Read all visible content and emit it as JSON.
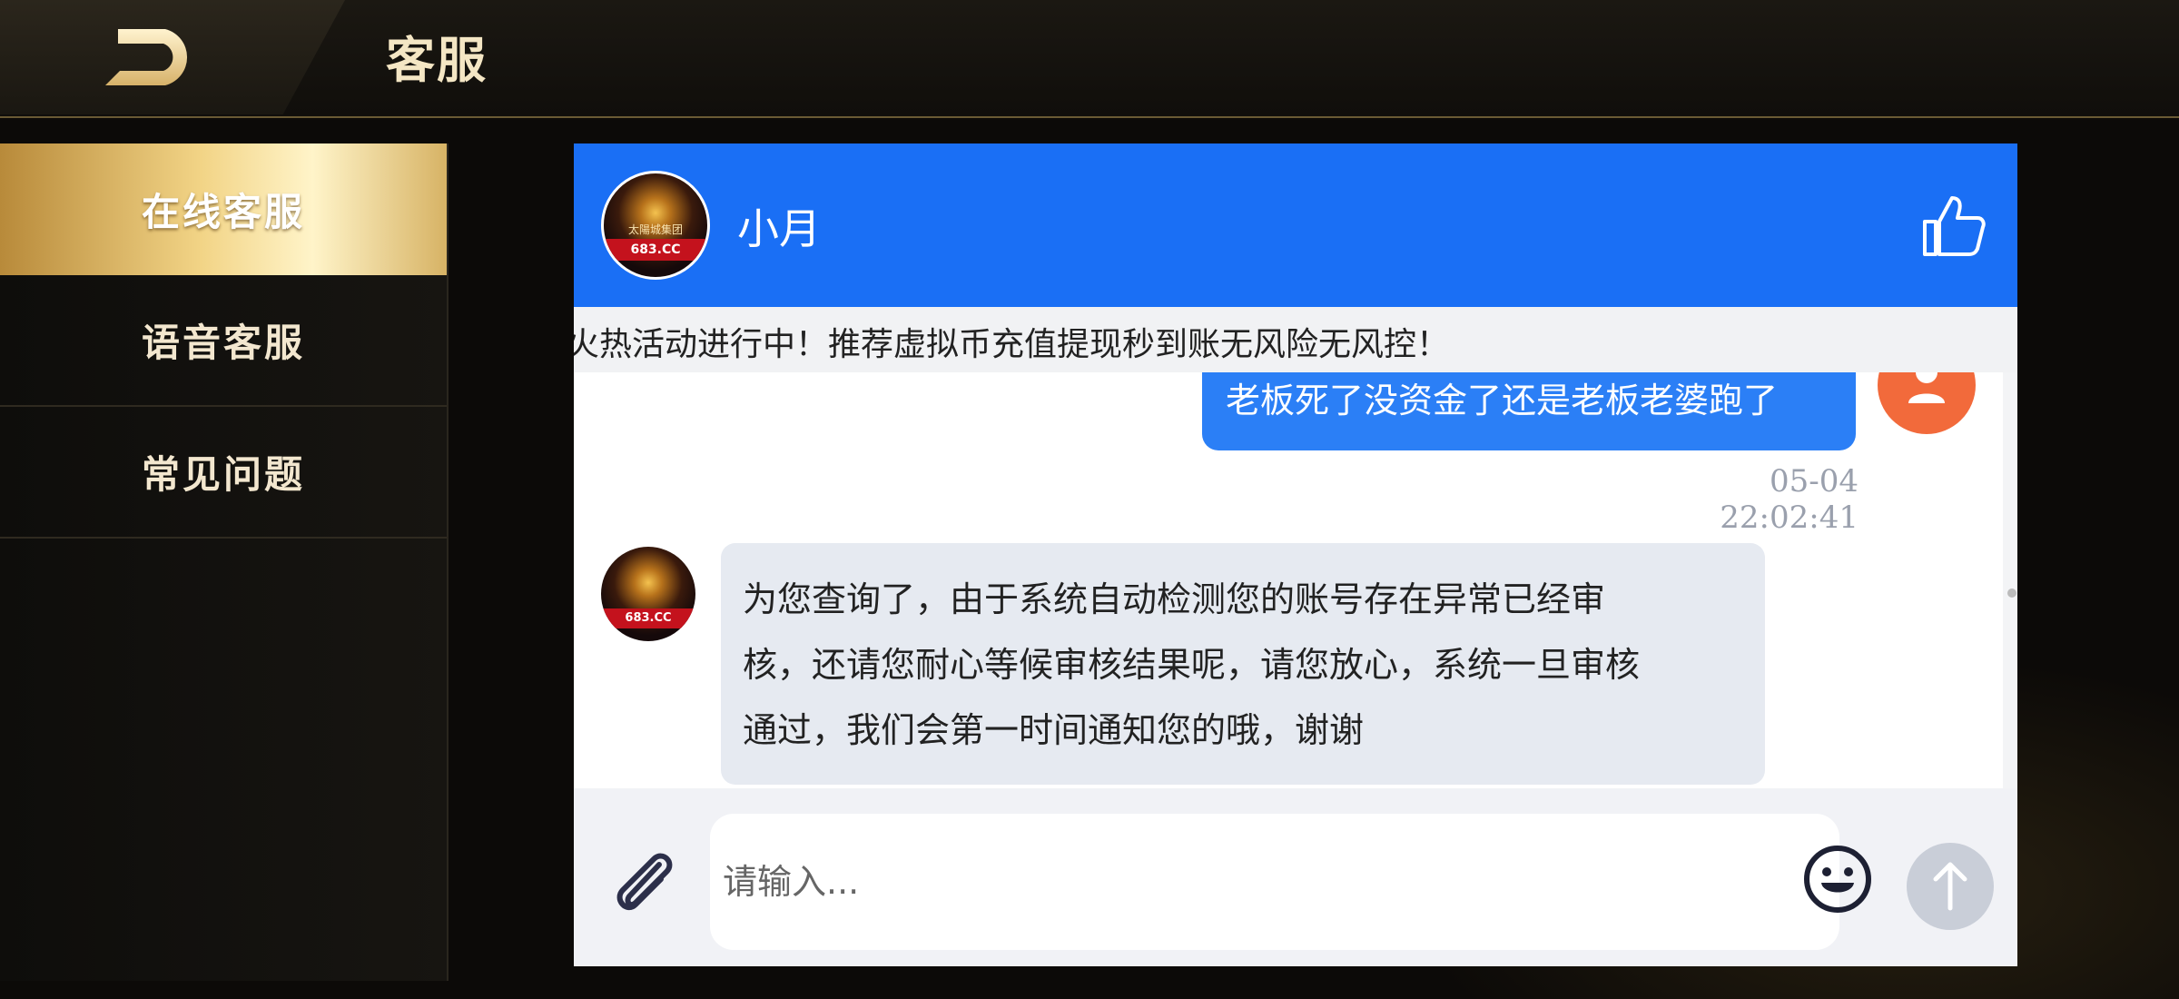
{
  "header": {
    "title": "客服",
    "back_icon": "back-arrow-icon"
  },
  "sidebar": {
    "items": [
      {
        "label": "在线客服",
        "active": true
      },
      {
        "label": "语音客服",
        "active": false
      },
      {
        "label": "常见问题",
        "active": false
      }
    ]
  },
  "chat": {
    "agent_name": "小月",
    "avatar_brand": "太陽城集团",
    "avatar_tag": "683.CC",
    "marquee_text": "火热活动进行中！推荐虚拟币充值提现秒到账无风险无风控！",
    "messages": {
      "user_text": "老板死了没资金了还是老板老婆跑了",
      "timestamp": "05-04 22:02:41",
      "agent_line1": "为您查询了，由于系统自动检测您的账号存在异常已经审",
      "agent_line2": "核，还请您耐心等候审核结果呢，请您放心，系统一旦审核",
      "agent_line3": "通过，我们会第一时间通知您的哦，谢谢"
    },
    "input_placeholder": "请输入..."
  },
  "colors": {
    "header_blue": "#1a6ff5",
    "user_bubble": "#2b7ff6",
    "agent_bubble": "#e6eaf1",
    "gold": "#f2d486"
  }
}
